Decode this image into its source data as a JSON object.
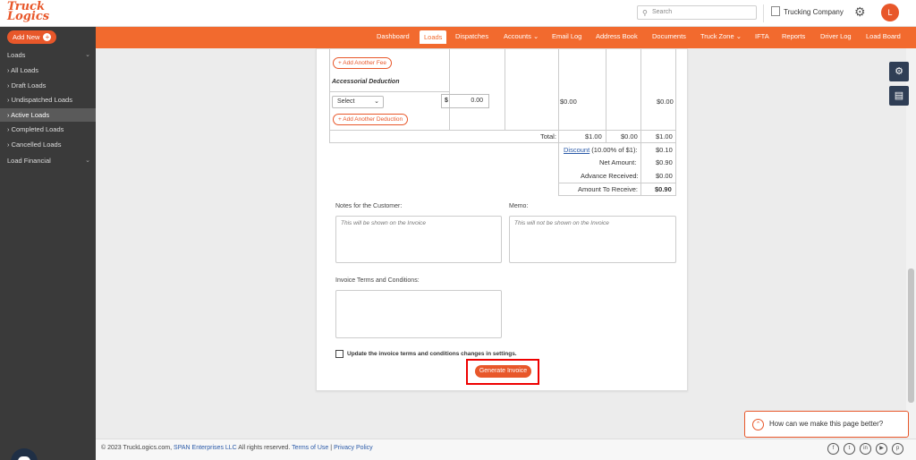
{
  "header": {
    "logo_line1": "Truck",
    "logo_line2": "Logics",
    "search_placeholder": "Search",
    "company": "Trucking Company",
    "avatar_initial": "L"
  },
  "sidebar": {
    "add_new": "Add New",
    "items": [
      {
        "label": "Loads"
      },
      {
        "label": "All Loads"
      },
      {
        "label": "Draft Loads"
      },
      {
        "label": "Undispatched Loads"
      },
      {
        "label": "Active Loads"
      },
      {
        "label": "Completed Loads"
      },
      {
        "label": "Cancelled Loads"
      },
      {
        "label": "Load Financial"
      }
    ]
  },
  "nav": {
    "items": [
      "Dashboard",
      "Loads",
      "Dispatches",
      "Accounts",
      "Email Log",
      "Address Book",
      "Documents",
      "Truck Zone",
      "IFTA",
      "Reports",
      "Driver Log",
      "Load Board"
    ]
  },
  "invoice": {
    "add_fee": "Add Another Fee",
    "accessorial_deduction": "Accessorial Deduction",
    "select_value": "Select",
    "currency": "$",
    "amount_value": "0.00",
    "deduction_col3": "$0.00",
    "deduction_col6": "$0.00",
    "add_deduction": "Add Another Deduction",
    "total_label": "Total:",
    "total_c3": "$1.00",
    "total_c4": "$0.00",
    "total_c6": "$1.00",
    "discount_link": "Discount",
    "discount_note": "(10.00% of $1):",
    "discount_val": "$0.10",
    "net_label": "Net Amount:",
    "net_val": "$0.90",
    "advance_label": "Advance Received:",
    "advance_val": "$0.00",
    "receive_label": "Amount To Receive:",
    "receive_val": "$0.90",
    "notes_label": "Notes for the Customer:",
    "notes_placeholder": "This will be shown on the Invoice",
    "memo_label": "Memo:",
    "memo_placeholder": "This will not be shown on the Invoice",
    "terms_label": "Invoice Terms and Conditions:",
    "update_terms": "Update the invoice terms and conditions changes in settings.",
    "generate": "Generate Invoice"
  },
  "feedback": {
    "text": "How can we make this page better?"
  },
  "footer": {
    "copy_prefix": "© 2023 TruckLogics.com,",
    "span": "SPAN Enterprises LLC",
    "rights": "All rights reserved.",
    "terms": "Terms of Use",
    "sep": "|",
    "privacy": "Privacy Policy"
  },
  "colors": {
    "brand": "#f26a2e",
    "sidebar": "#3a3a3a",
    "highlight": "#e00000"
  }
}
